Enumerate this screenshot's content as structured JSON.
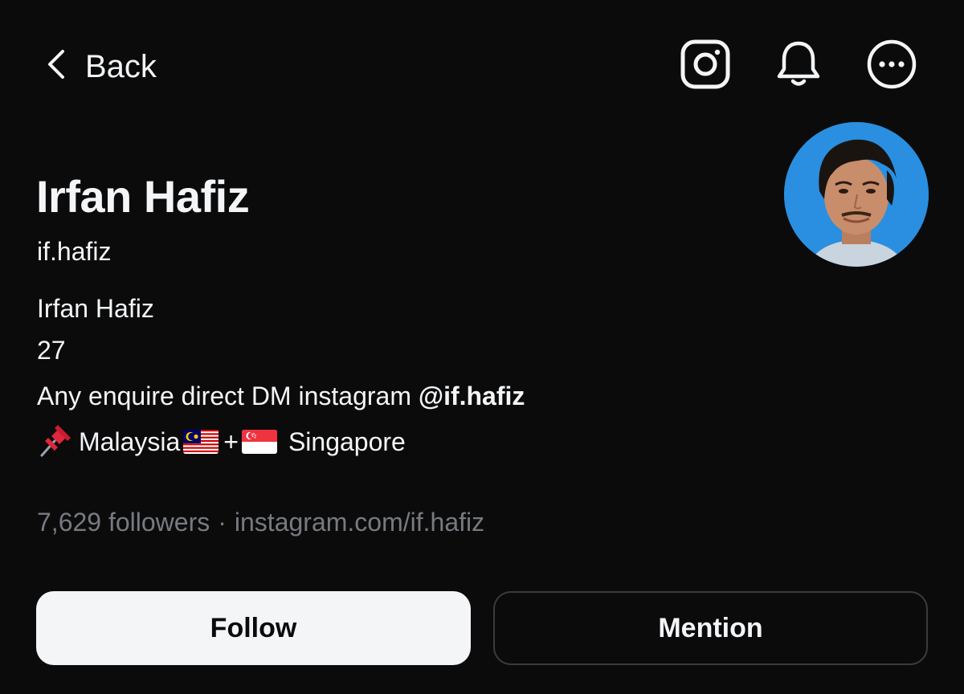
{
  "nav": {
    "back_label": "Back",
    "icons": [
      "chevron-left-icon",
      "instagram-icon",
      "bell-icon",
      "more-icon"
    ]
  },
  "profile": {
    "display_name": "Irfan Hafiz",
    "username": "if.hafiz",
    "bio": {
      "line1": "Irfan Hafiz",
      "line2": "27",
      "line3_text": "Any enquire direct DM instagram ",
      "line3_mention": "@if.hafiz",
      "line4_malaysia": "Malaysia",
      "line4_plus": "+",
      "line4_singapore": "Singapore"
    },
    "followers": "7,629 followers",
    "separator": "·",
    "link": "instagram.com/if.hafiz"
  },
  "actions": {
    "follow_label": "Follow",
    "mention_label": "Mention"
  },
  "colors": {
    "background": "#0b0b0c",
    "text": "#f3f5f7",
    "muted": "#777a7f",
    "avatar_bg": "#2a8fe0",
    "follow_bg": "#f3f5f7"
  }
}
